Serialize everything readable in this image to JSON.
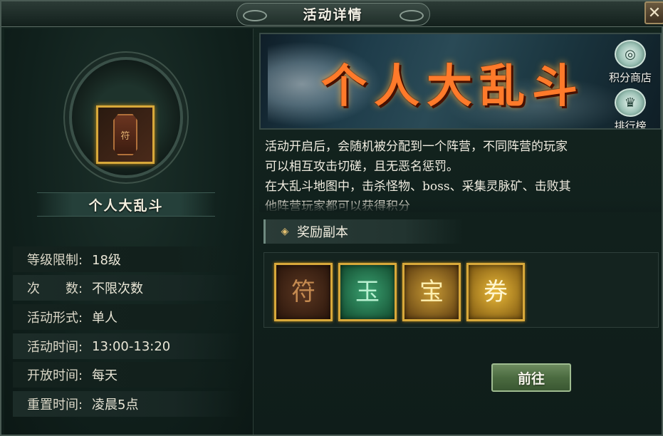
{
  "window": {
    "title": "活动详情",
    "close_label": "✕"
  },
  "activity": {
    "name": "个人大乱斗",
    "icon_glyph": "符"
  },
  "info": [
    {
      "label": "等级限制:",
      "value": "18级"
    },
    {
      "label": "次　　数:",
      "value": "不限次数"
    },
    {
      "label": "活动形式:",
      "value": "单人"
    },
    {
      "label": "活动时间:",
      "value": "13:00-13:20"
    },
    {
      "label": "开放时间:",
      "value": "每天"
    },
    {
      "label": "重置时间:",
      "value": "凌晨5点"
    }
  ],
  "banner": {
    "title": "个人大乱斗",
    "shop_label": "积分商店",
    "shop_icon": "coin-icon",
    "rank_label": "排行榜",
    "rank_icon": "ranking-icon"
  },
  "description": {
    "line1": "活动开启后，会随机被分配到一个阵营，不同阵营的玩家",
    "line2": "可以相互攻击切磋，且无恶名惩罚。",
    "line3": "在大乱斗地图中，击杀怪物、boss、采集灵脉矿、击败其",
    "line4": "他阵营玩家都可以获得积分"
  },
  "rewards": {
    "header": "奖励副本",
    "items": [
      {
        "name": "token-icon",
        "glyph": "符",
        "bg": "#3a2214"
      },
      {
        "name": "jade-token-icon",
        "glyph": "玉",
        "bg": "#1e5a3c"
      },
      {
        "name": "treasure-chest-icon",
        "glyph": "宝",
        "bg": "#6a4a14"
      },
      {
        "name": "gold-ticket-icon",
        "glyph": "券",
        "bg": "#8a6a18"
      }
    ]
  },
  "go_button": "前往",
  "colors": {
    "accent_gold": "#d8a83a",
    "banner_title": "#ff7a2a",
    "button_green": "#4b6b40"
  }
}
